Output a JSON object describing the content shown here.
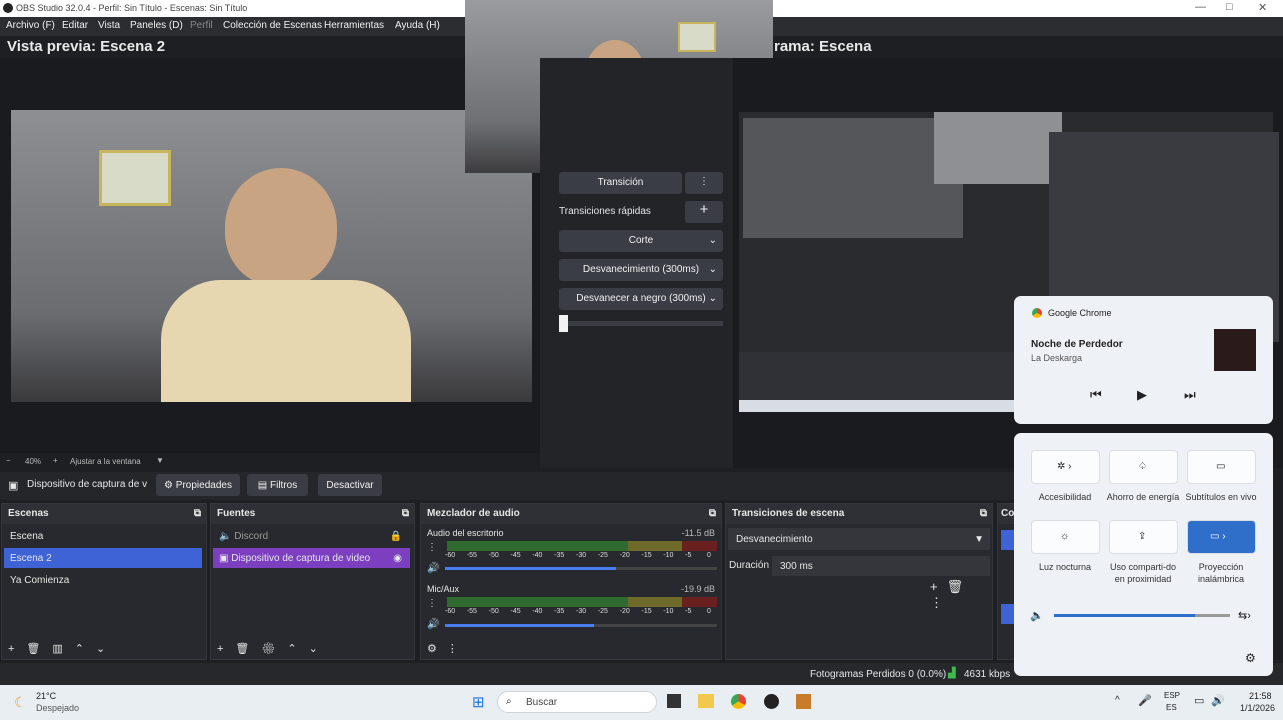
{
  "window": {
    "title": "OBS Studio 32.0.4 - Perfil: Sin Título - Escenas: Sin Título"
  },
  "menu": [
    "Archivo (F)",
    "Editar",
    "Vista",
    "Paneles (D)",
    "Perfil",
    "Colección de Escenas",
    "Herramientas",
    "Ayuda (H)"
  ],
  "preview": {
    "title": "Vista previa: Escena 2",
    "zoom": "40%",
    "fit": "Ajustar a la ventana"
  },
  "program": {
    "title": "rama: Escena"
  },
  "transition_panel": {
    "transition": "Transición",
    "quick": "Transiciones rápidas",
    "items": [
      "Corte",
      "Desvanecimiento (300ms)",
      "Desvanecer a negro (300ms)"
    ]
  },
  "context_bar": {
    "source": "Dispositivo de captura de v",
    "props": "Propiedades",
    "filters": "Filtros",
    "deactivate": "Desactivar"
  },
  "scenes": {
    "title": "Escenas",
    "items": [
      "Escena",
      "Escena 2",
      "Ya Comienza"
    ],
    "selected": 1
  },
  "sources": {
    "title": "Fuentes",
    "items": [
      "Discord",
      "Dispositivo de captura de video"
    ]
  },
  "mixer": {
    "title": "Mezclador de audio",
    "ticks": [
      "-60",
      "-55",
      "-50",
      "-45",
      "-40",
      "-35",
      "-30",
      "-25",
      "-20",
      "-15",
      "-10",
      "-5",
      "0"
    ],
    "channels": [
      {
        "name": "Audio del escritorio",
        "db": "-11.5 dB",
        "level": 0.95
      },
      {
        "name": "Mic/Aux",
        "db": "-19.9 dB",
        "level": 0.83
      }
    ]
  },
  "scene_transitions": {
    "title": "Transiciones de escena",
    "selected": "Desvanecimiento",
    "duration_label": "Duración",
    "duration": "300 ms"
  },
  "controls": {
    "title": "Co"
  },
  "status": {
    "dropped": "Fotogramas Perdidos 0 (0.0%)",
    "bitrate": "4631 kbps"
  },
  "media": {
    "app": "Google Chrome",
    "track": "Noche de Perdedor",
    "artist": "La Deskarga"
  },
  "quick_settings": {
    "tiles": [
      "Accesibilidad",
      "Ahorro de energía",
      "Subtítulos en vivo",
      "Luz nocturna",
      "Uso comparti-do en proximidad",
      "Proyección inalámbrica"
    ],
    "volume": 0.8
  },
  "taskbar": {
    "temp": "21°C",
    "weather": "Despejado",
    "search": "Buscar",
    "lang1": "ESP",
    "lang2": "ES",
    "time": "21:58",
    "date": "1/1/2026"
  },
  "colors": {
    "accent": "#3e63d6",
    "source_sel": "#7c3fbf",
    "bg": "#1e1f22"
  }
}
